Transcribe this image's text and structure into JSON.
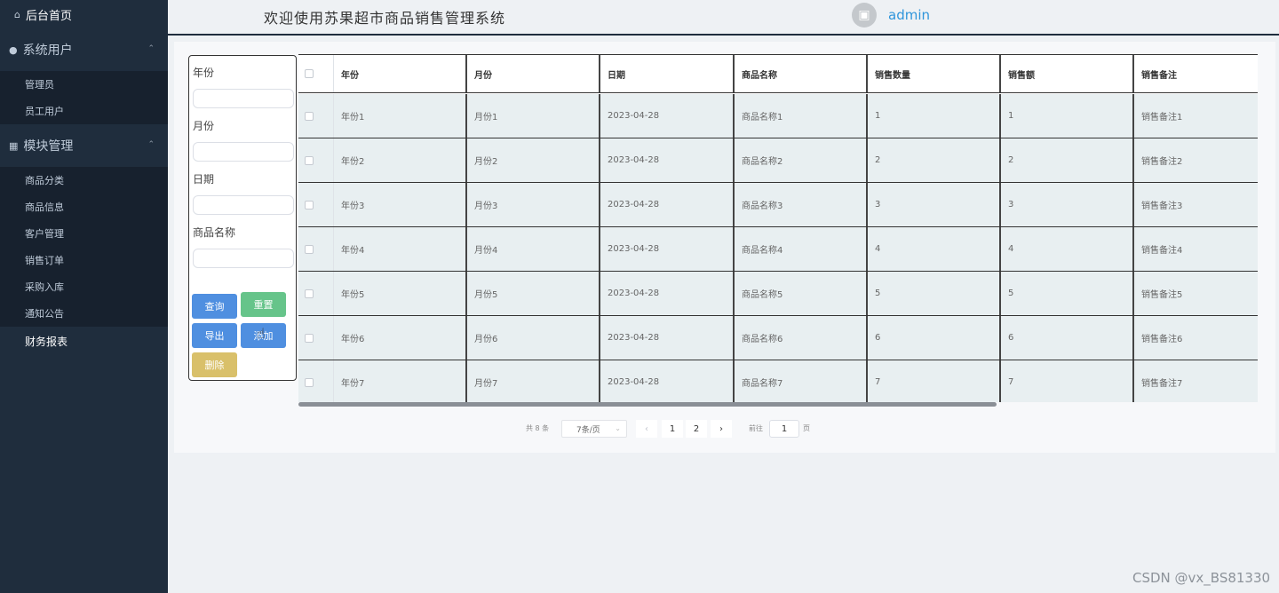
{
  "sidebar": {
    "home": "后台首页",
    "group1": {
      "label": "系统用户",
      "items": [
        "管理员",
        "员工用户"
      ]
    },
    "group2": {
      "label": "模块管理",
      "items": [
        "商品分类",
        "商品信息",
        "客户管理",
        "销售订单",
        "采购入库",
        "通知公告"
      ]
    },
    "finance": "财务报表"
  },
  "header": {
    "title": "欢迎使用苏果超市商品销售管理系统",
    "username": "admin"
  },
  "search": {
    "labels": [
      "年份",
      "月份",
      "日期",
      "商品名称"
    ],
    "buttons": {
      "query": "查询",
      "reset": "重置",
      "export": "导出",
      "add": "添加",
      "delete": "删除"
    }
  },
  "table": {
    "columns": [
      "年份",
      "月份",
      "日期",
      "商品名称",
      "销售数量",
      "销售额",
      "销售备注"
    ],
    "rows": [
      [
        "年份1",
        "月份1",
        "2023-04-28",
        "商品名称1",
        "1",
        "1",
        "销售备注1"
      ],
      [
        "年份2",
        "月份2",
        "2023-04-28",
        "商品名称2",
        "2",
        "2",
        "销售备注2"
      ],
      [
        "年份3",
        "月份3",
        "2023-04-28",
        "商品名称3",
        "3",
        "3",
        "销售备注3"
      ],
      [
        "年份4",
        "月份4",
        "2023-04-28",
        "商品名称4",
        "4",
        "4",
        "销售备注4"
      ],
      [
        "年份5",
        "月份5",
        "2023-04-28",
        "商品名称5",
        "5",
        "5",
        "销售备注5"
      ],
      [
        "年份6",
        "月份6",
        "2023-04-28",
        "商品名称6",
        "6",
        "6",
        "销售备注6"
      ],
      [
        "年份7",
        "月份7",
        "2023-04-28",
        "商品名称7",
        "7",
        "7",
        "销售备注7"
      ]
    ]
  },
  "pagination": {
    "total": "共 8 条",
    "page_size": "7条/页",
    "pages": [
      "1",
      "2"
    ],
    "goto_label": "前往",
    "goto_value": "1",
    "goto_unit": "页"
  },
  "watermark": "CSDN @vx_BS81330",
  "icons": {
    "home": "home-icon",
    "user": "user-icon",
    "grid": "grid-icon",
    "avatar": "image-icon"
  }
}
